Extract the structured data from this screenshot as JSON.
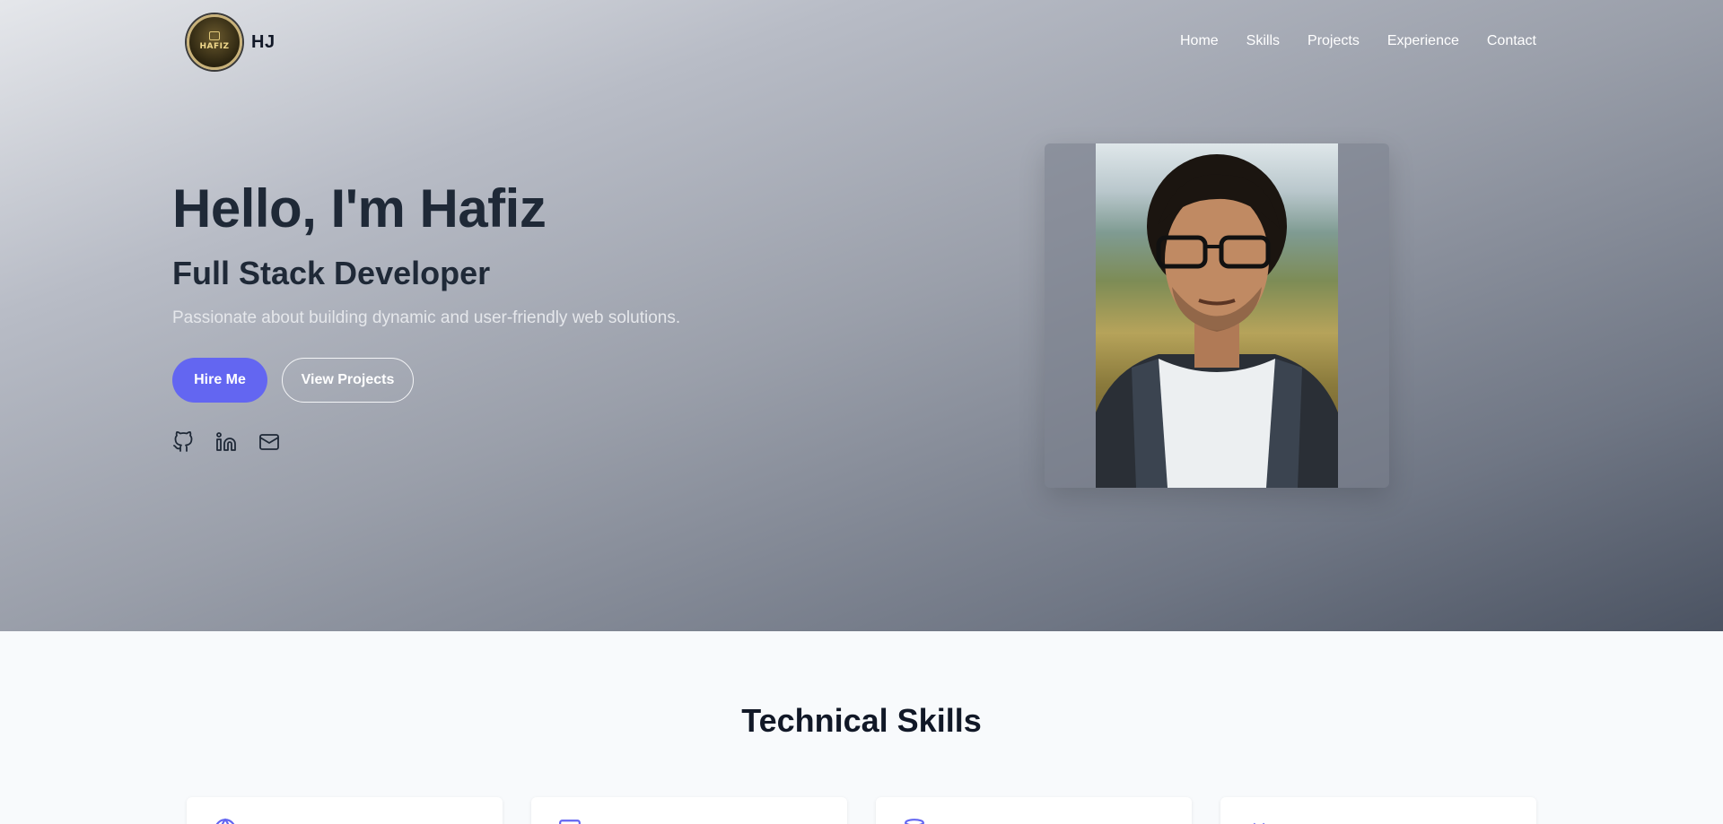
{
  "brand": {
    "badge_text": "HAFIZ",
    "badge_tagline": "",
    "name": "HJ"
  },
  "nav": {
    "items": [
      "Home",
      "Skills",
      "Projects",
      "Experience",
      "Contact"
    ]
  },
  "hero": {
    "title": "Hello, I'm Hafiz",
    "subtitle": "Full Stack Developer",
    "description": "Passionate about building dynamic and user-friendly web solutions.",
    "primary_button": "Hire Me",
    "secondary_button": "View Projects"
  },
  "social": [
    {
      "icon": "github-icon"
    },
    {
      "icon": "linkedin-icon"
    },
    {
      "icon": "mail-icon"
    }
  ],
  "skills": {
    "title": "Technical Skills",
    "cards": [
      {
        "icon": "globe-icon"
      },
      {
        "icon": "monitor-icon"
      },
      {
        "icon": "database-icon"
      },
      {
        "icon": "code-icon"
      }
    ]
  },
  "colors": {
    "accent": "#6366f1",
    "hero_dark": "#4b5362",
    "text": "#1f2937"
  }
}
